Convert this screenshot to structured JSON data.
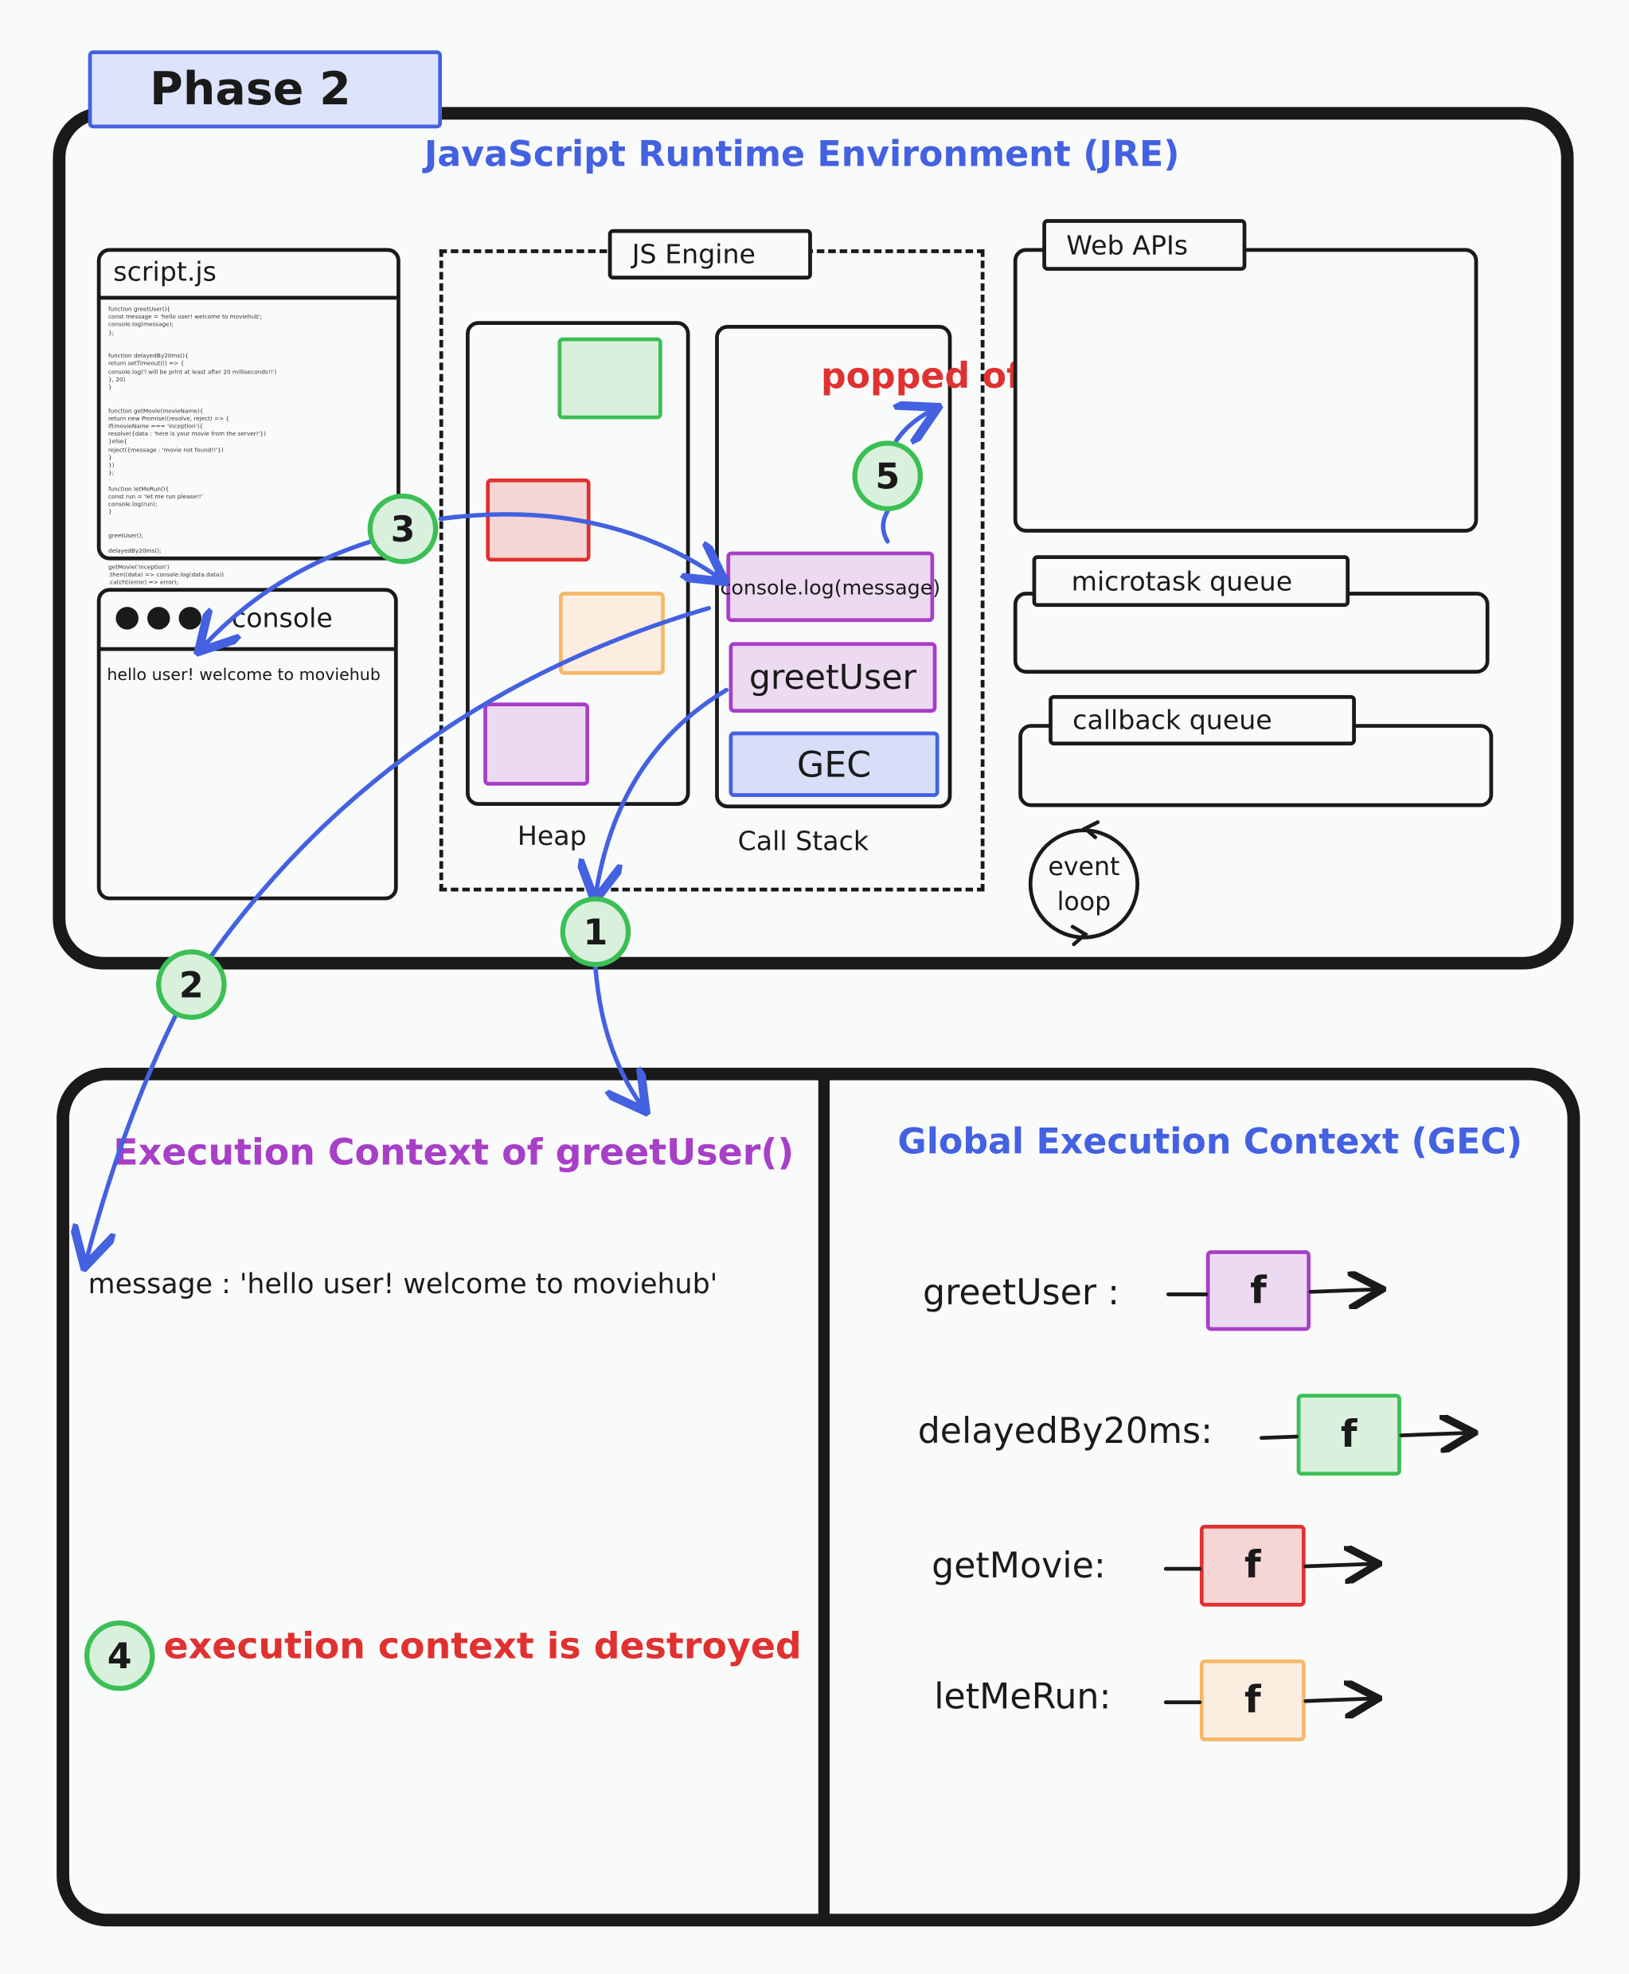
{
  "phase_label": "Phase 2",
  "jre": {
    "title": "JavaScript Runtime Environment (JRE)",
    "script": {
      "title": "script.js",
      "code": "function greetUser(){\nconst message = 'hello user! welcome to moviehub';\nconsole.log(message);\n};\n\n\nfunction delayedBy20ms(){\nreturn setTimeout(() => {\nconsole.log('i will be print at least after 20 milliseconds!!')\n}, 20)\n}\n\n\nfunction getMovie(movieName){\nreturn new Promise((resolve, reject) => {\nif(movieName === 'inception'){\nresolve({data : 'here is your movie from the server!'})\n}else{\nreject({message : 'movie not found!!'})\n}\n})\n};\n\nfunction letMeRun(){\nconst run = 'let me run please!!'\nconsole.log(run);\n}\n\n\ngreetUser();\n\ndelayedBy20ms();\n\ngetMovie('inception')\n.then((data) => console.log(data.data))\n.catch((error) => error);\n\nletMeRun();"
    },
    "console": {
      "title": "console",
      "output": "hello user! welcome to moviehub"
    },
    "engine": {
      "title": "JS Engine",
      "heap_label": "Heap",
      "call_stack_label": "Call Stack",
      "stack": [
        "console.log(message)",
        "greetUser",
        "GEC"
      ],
      "popped_label": "popped off"
    },
    "web_apis": "Web APIs",
    "microtask_queue": "microtask queue",
    "callback_queue": "callback queue",
    "event_loop": "event loop"
  },
  "steps": [
    "1",
    "2",
    "3",
    "4",
    "5"
  ],
  "exec_context": {
    "title": "Execution Context of greetUser()",
    "message_line": "message : 'hello user! welcome to moviehub'",
    "destroyed": "execution context is destroyed"
  },
  "gec": {
    "title": "Global Execution Context (GEC)",
    "entries": [
      {
        "name": "greetUser :",
        "value": "f",
        "color": "#a73fc7"
      },
      {
        "name": "delayedBy20ms:",
        "value": "f",
        "color": "#3cbf55"
      },
      {
        "name": "getMovie:",
        "value": "f",
        "color": "#e03131"
      },
      {
        "name": "letMeRun:",
        "value": "f",
        "color": "#f5b86a"
      }
    ]
  },
  "colors": {
    "blue": "#4361e0",
    "green": "#3cbf55",
    "red": "#e03131",
    "orange": "#f5b86a",
    "purple": "#a73fc7"
  }
}
